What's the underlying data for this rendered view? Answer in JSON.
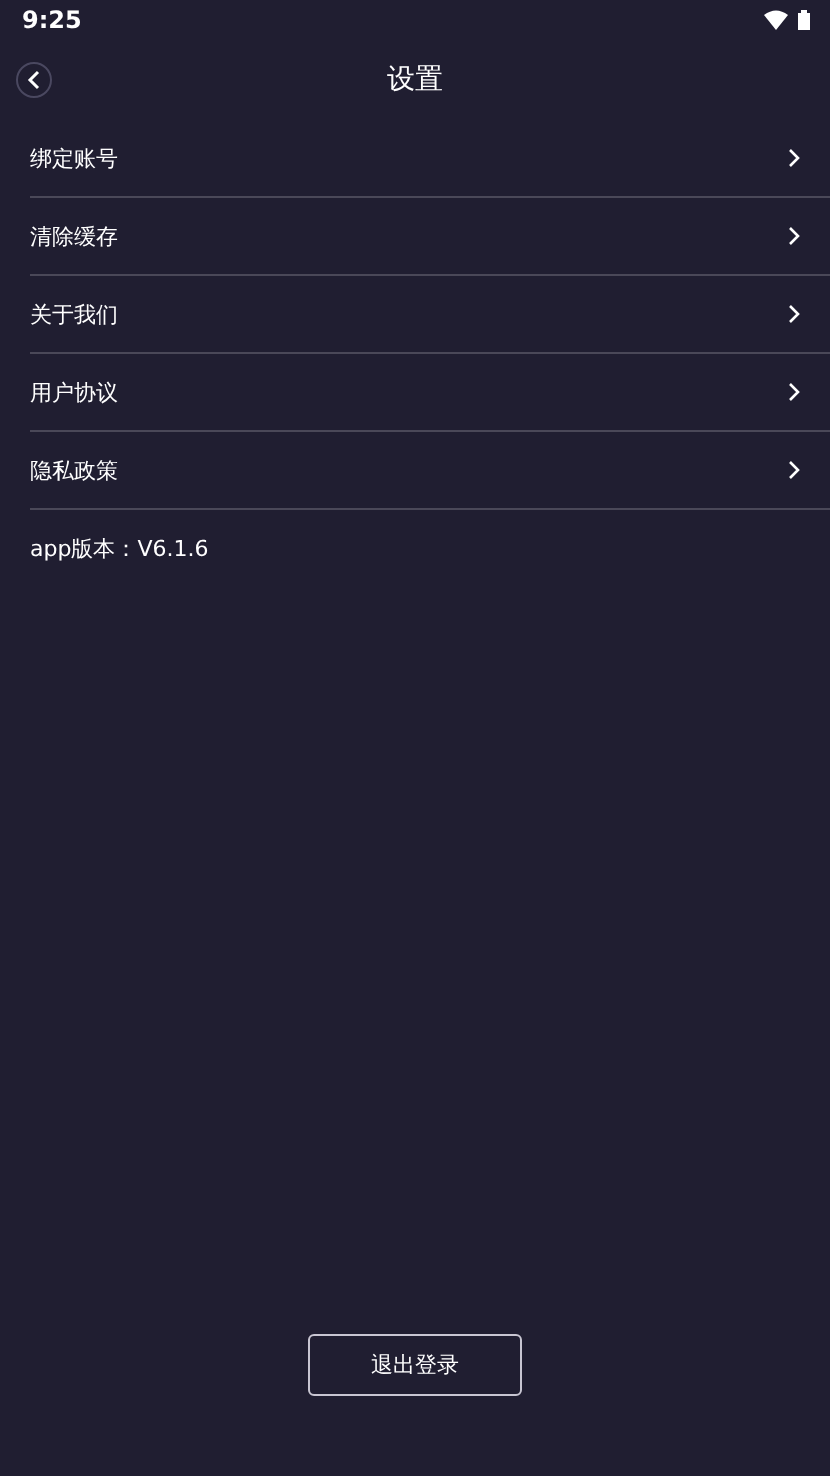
{
  "status_bar": {
    "time": "9:25"
  },
  "header": {
    "title": "设置"
  },
  "menu": [
    {
      "label": "绑定账号"
    },
    {
      "label": "清除缓存"
    },
    {
      "label": "关于我们"
    },
    {
      "label": "用户协议"
    },
    {
      "label": "隐私政策"
    }
  ],
  "version": "app版本：V6.1.6",
  "logout_button": "退出登录"
}
